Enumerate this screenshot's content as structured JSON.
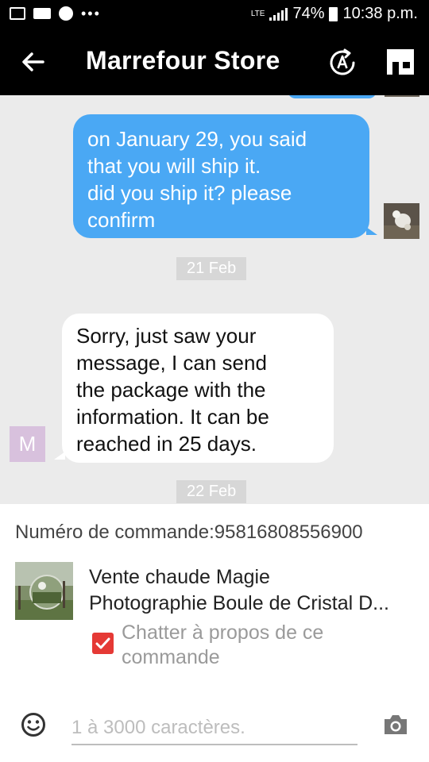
{
  "status_bar": {
    "network": "LTE",
    "battery": "74%",
    "time": "10:38 p.m.",
    "icons": [
      "gallery-icon",
      "mail-icon",
      "messenger-icon",
      "more-dots-icon",
      "signal-icon",
      "battery-icon"
    ]
  },
  "header": {
    "title": "Marrefour Store",
    "icons": [
      "back-arrow-icon",
      "auto-translate-icon",
      "store-icon"
    ]
  },
  "messages": [
    {
      "direction": "out",
      "lines": [
        "on January 29, you said",
        "that you will ship it.",
        "did you ship it? please",
        "confirm"
      ]
    },
    {
      "direction": "date",
      "text": "21 Feb"
    },
    {
      "direction": "in",
      "avatar_letter": "M",
      "lines": [
        "Sorry, just saw your",
        "message, I can send",
        "the package with the",
        "information. It can be",
        "reached in 25 days."
      ]
    },
    {
      "direction": "date",
      "text": "22 Feb"
    }
  ],
  "order": {
    "number_label": "Numéro de commande:",
    "number_value": "95816808556900",
    "product_line1": "Vente chaude Magie",
    "product_line2": "Photographie Boule de Cristal D...",
    "chat_about_checked": true,
    "chat_about_label_line1": "Chatter à propos de ce",
    "chat_about_label_line2": "commande"
  },
  "composer": {
    "placeholder": "1 à 3000 caractères.",
    "value": "",
    "icons": [
      "emoji-icon",
      "camera-icon"
    ]
  },
  "colors": {
    "outgoing_bubble": "#4aa8f4",
    "incoming_bubble": "#ffffff",
    "chat_background": "#ebebeb",
    "header_background": "#000000",
    "checkbox": "#e53935",
    "avatar_m": "#d8c1dd"
  }
}
